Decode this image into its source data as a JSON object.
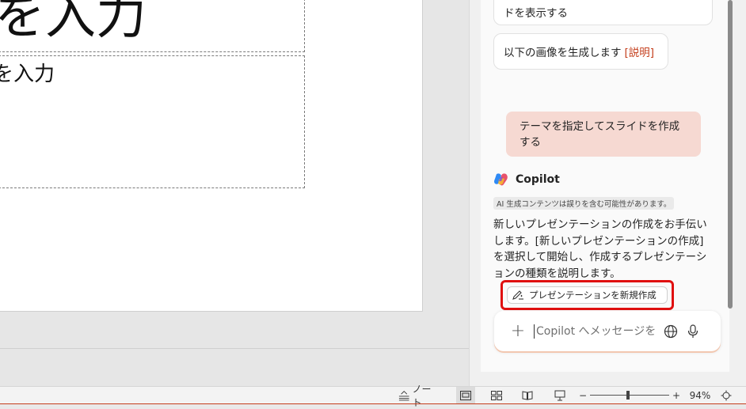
{
  "slide": {
    "title_text": "を入力",
    "body_text": "を入力"
  },
  "copilot": {
    "suggestions": [
      {
        "label": "ドを表示する"
      },
      {
        "label": "以下の画像を生成します",
        "ref": "[説明]"
      }
    ],
    "user_message": "テーマを指定してスライドを作成する",
    "assistant_name": "Copilot",
    "ai_disclaimer": "AI 生成コンテンツは誤りを含む可能性があります。",
    "reply": "新しいプレゼンテーションの作成をお手伝いします。[新しいプレゼンテーションの作成] を選択して開始し、作成するプレゼンテーションの種類を説明します。",
    "action_label": "プレゼンテーションを新規作成",
    "input_placeholder": "Copilot へメッセージを"
  },
  "statusbar": {
    "notes_label": "ノート",
    "zoom_minus": "−",
    "zoom_plus": "+",
    "zoom_value": "94%",
    "zoom_level_percent": 94
  },
  "colors": {
    "accent": "#c43e1c",
    "highlight_border": "#e01010",
    "user_bubble": "#f6d9d2"
  }
}
